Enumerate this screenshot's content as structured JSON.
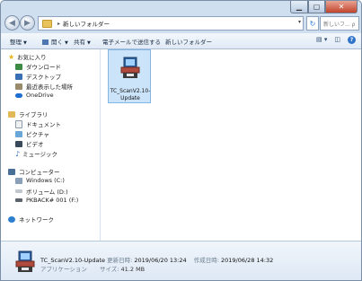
{
  "address": {
    "path_separator": "▸",
    "path": "新しいフォルダー",
    "search_placeholder": "新しいフ... ρ"
  },
  "toolbar": {
    "organize": "整理",
    "open": "開く",
    "share": "共有",
    "email": "電子メールで送信する",
    "new_folder": "新しいフォルダー"
  },
  "nav": {
    "favorites": "お気に入り",
    "downloads": "ダウンロード",
    "desktop": "デスクトップ",
    "recent": "最近表示した場所",
    "onedrive": "OneDrive",
    "libraries": "ライブラリ",
    "documents": "ドキュメント",
    "pictures": "ピクチャ",
    "videos": "ビデオ",
    "music": "ミュージック",
    "computer": "コンピューター",
    "drive_c": "Windows (C:)",
    "drive_d": "ボリューム (D:)",
    "drive_f": "PKBACK# 001 (F:)",
    "network": "ネットワーク"
  },
  "file": {
    "name_line1": "TC_ScanV2.10-",
    "name_line2": "Update"
  },
  "details": {
    "name": "TC_ScanV2.10-Update",
    "modified_label": "更新日時:",
    "modified_value": "2019/06/20 13:24",
    "created_label": "作成日時:",
    "created_value": "2019/06/28 14:32",
    "type": "アプリケーション",
    "size_label": "サイズ:",
    "size_value": "41.2 MB"
  },
  "colors": {
    "selection_bg": "#cce4fa",
    "chrome": "#cfdff0",
    "close_button": "#c2432b"
  }
}
